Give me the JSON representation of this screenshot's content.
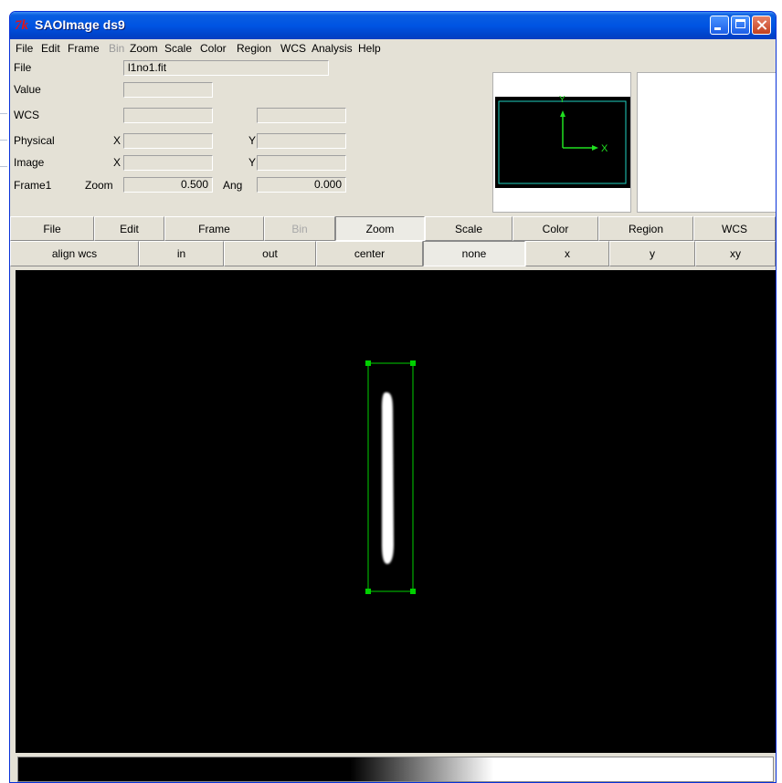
{
  "window": {
    "title": "SAOImage ds9",
    "app_icon_text": "7k"
  },
  "menubar": [
    {
      "label": "File",
      "disabled": false
    },
    {
      "label": "Edit",
      "disabled": false
    },
    {
      "label": "Frame",
      "disabled": false
    },
    {
      "label": "Bin",
      "disabled": true
    },
    {
      "label": "Zoom",
      "disabled": false
    },
    {
      "label": "Scale",
      "disabled": false
    },
    {
      "label": "Color",
      "disabled": false
    },
    {
      "label": "Region",
      "disabled": false
    },
    {
      "label": "WCS",
      "disabled": false
    },
    {
      "label": "Analysis",
      "disabled": false
    },
    {
      "label": "Help",
      "disabled": false
    }
  ],
  "info": {
    "file_label": "File",
    "file_value": "l1no1.fit",
    "value_label": "Value",
    "value": "",
    "wcs_label": "WCS",
    "wcs_value1": "",
    "wcs_value2": "",
    "physical_label": "Physical",
    "physical_x_label": "X",
    "physical_x": "",
    "physical_y_label": "Y",
    "physical_y": "",
    "image_label": "Image",
    "image_x_label": "X",
    "image_x": "",
    "image_y_label": "Y",
    "image_y": "",
    "frame_label": "Frame1",
    "zoom_label": "Zoom",
    "zoom_value": "0.500",
    "angle_label": "Ang",
    "angle_value": "0.000"
  },
  "magnifier": {
    "x_axis_label": "X",
    "y_axis_label": "Y",
    "colors": {
      "box": "#1fd0c0",
      "axes": "#20e020"
    }
  },
  "buttonbar": {
    "main": [
      {
        "label": "File"
      },
      {
        "label": "Edit"
      },
      {
        "label": "Frame"
      },
      {
        "label": "Bin",
        "disabled": true
      },
      {
        "label": "Zoom",
        "selected": true
      },
      {
        "label": "Scale"
      },
      {
        "label": "Color"
      },
      {
        "label": "Region"
      },
      {
        "label": "WCS"
      }
    ],
    "zoom": [
      {
        "label": "align wcs"
      },
      {
        "label": "in"
      },
      {
        "label": "out"
      },
      {
        "label": "center"
      },
      {
        "label": "none",
        "selected": true
      },
      {
        "label": "x"
      },
      {
        "label": "y"
      },
      {
        "label": "xy"
      }
    ]
  },
  "image": {
    "region_shape": "box",
    "region_color": "#00d000",
    "source_color": "#ffffff"
  },
  "colorbar": {
    "colormap": "grey"
  }
}
